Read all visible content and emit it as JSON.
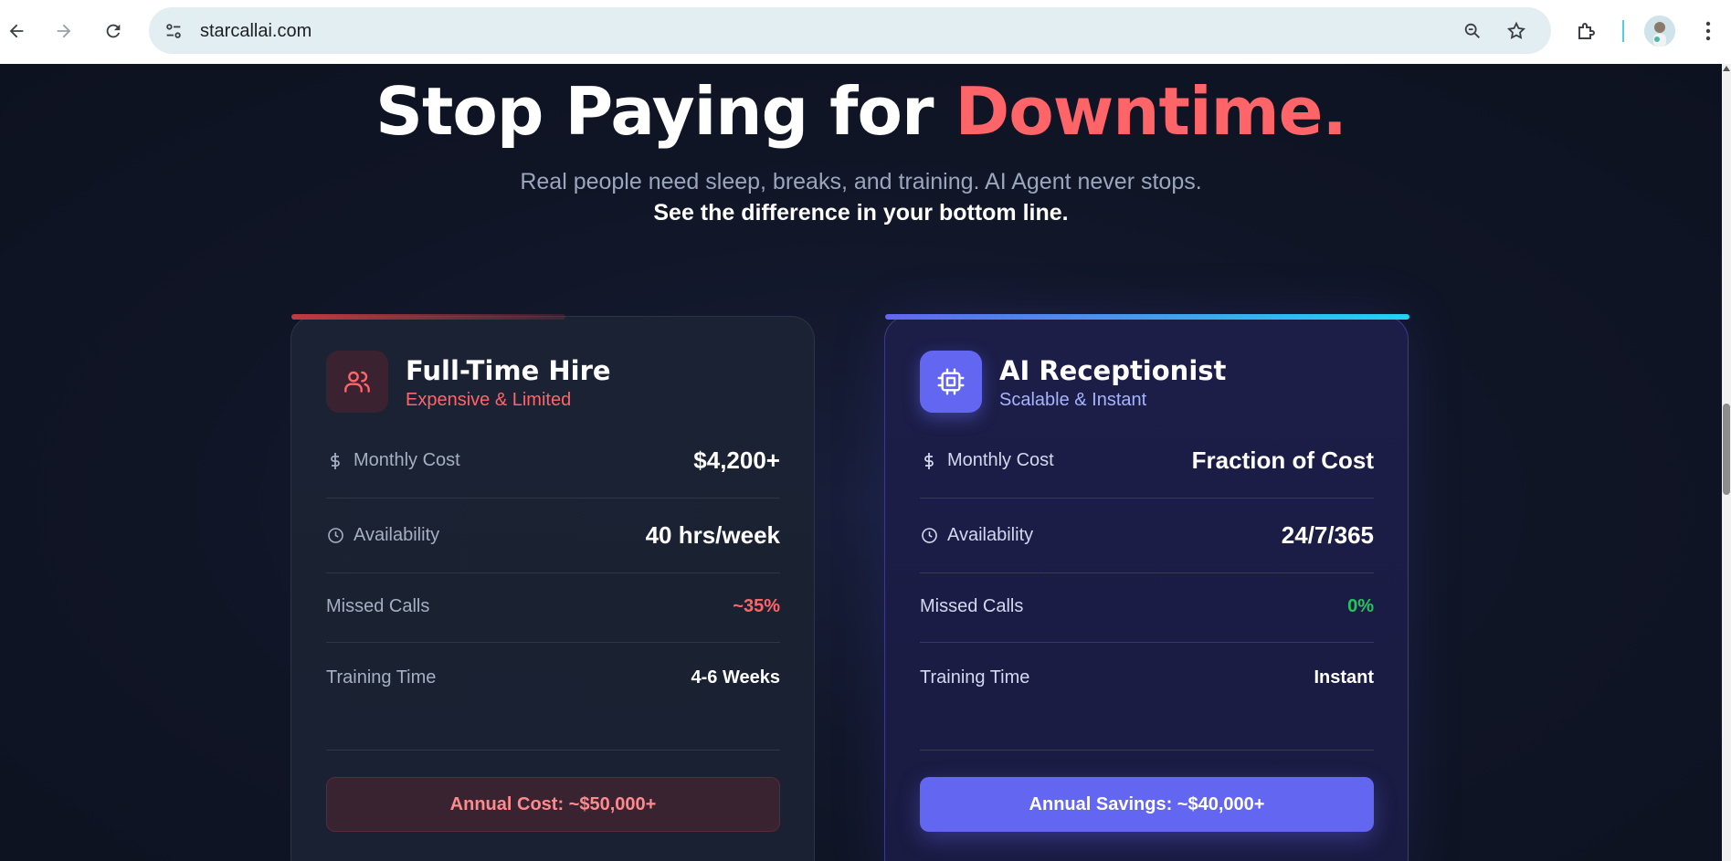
{
  "browser": {
    "url": "starcallai.com",
    "icons": [
      "back-arrow-icon",
      "forward-arrow-icon",
      "reload-icon",
      "site-settings-icon",
      "zoom-icon",
      "bookmark-star-icon",
      "extensions-puzzle-icon",
      "profile-avatar",
      "kebab-menu-icon"
    ]
  },
  "hero": {
    "headline_prefix": "Stop Paying for ",
    "headline_accent": "Downtime.",
    "subtitle": "Real people need sleep, breaks, and training. AI Agent never stops.",
    "subtitle_bold": "See the difference in your bottom line."
  },
  "cards": {
    "human": {
      "title": "Full-Time Hire",
      "subtitle": "Expensive & Limited",
      "icon": "users-icon",
      "rows": [
        {
          "label": "Monthly Cost",
          "value": "$4,200+",
          "icon": "dollar-icon"
        },
        {
          "label": "Availability",
          "value": "40 hrs/week",
          "icon": "clock-icon"
        },
        {
          "label": "Missed Calls",
          "value": "~35%"
        },
        {
          "label": "Training Time",
          "value": "4-6 Weeks"
        }
      ],
      "cta": "Annual Cost: ~$50,000+"
    },
    "ai": {
      "title": "AI Receptionist",
      "subtitle": "Scalable & Instant",
      "icon": "cpu-chip-icon",
      "rows": [
        {
          "label": "Monthly Cost",
          "value": "Fraction of Cost",
          "icon": "dollar-icon"
        },
        {
          "label": "Availability",
          "value": "24/7/365",
          "icon": "clock-icon"
        },
        {
          "label": "Missed Calls",
          "value": "0%"
        },
        {
          "label": "Training Time",
          "value": "Instant"
        }
      ],
      "cta": "Annual Savings: ~$40,000+"
    }
  },
  "colors": {
    "accent_red": "#ff6468",
    "accent_green": "#22c55e",
    "accent_indigo": "#6366f1",
    "accent_cyan": "#22d3ee",
    "page_bg": "#0d1322"
  }
}
